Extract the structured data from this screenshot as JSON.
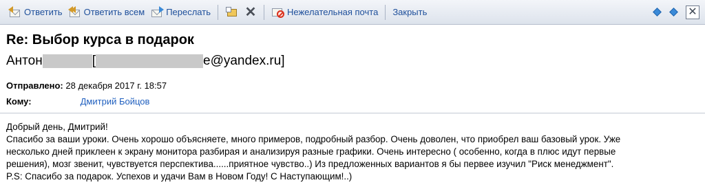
{
  "toolbar": {
    "reply_label": "Ответить",
    "reply_all_label": "Ответить всем",
    "forward_label": "Переслать",
    "junk_label": "Нежелательная почта",
    "close_label": "Закрыть",
    "close_symbol": "✕",
    "delete_symbol": "✕"
  },
  "message": {
    "subject": "Re: Выбор курса в подарок",
    "sender_name": "Антон",
    "sender_open_bracket": "[",
    "sender_email_visible": "e@yandex.ru]",
    "sent_label": "Отправлено:",
    "sent_value": "28 декабря 2017 г. 18:57",
    "to_label": "Кому:",
    "to_value": "Дмитрий Бойцов"
  },
  "body": {
    "lines": [
      "Добрый день, Дмитрий!",
      "Спасибо за ваши уроки. Очень хорошо объясняете, много примеров, подробный разбор. Очень доволен, что приобрел ваш базовый урок. Уже",
      "несколько дней приклеен к экрану монитора разбирая и анализируя разные графики. Очень интересно ( особенно, когда в плюс идут первые",
      "решения), мозг звенит, чувствуется перспектива......приятное чувство..) Из предложенных вариантов я бы первее изучил \"Риск менеджмент\".",
      "P.S: Спасибо за подарок. Успехов и удачи Вам в Новом Году! С Наступающим!..)"
    ]
  },
  "colors": {
    "toolbar_text": "#1e4f9b",
    "link": "#1f5fbf",
    "redaction": "#c9c9c9"
  }
}
